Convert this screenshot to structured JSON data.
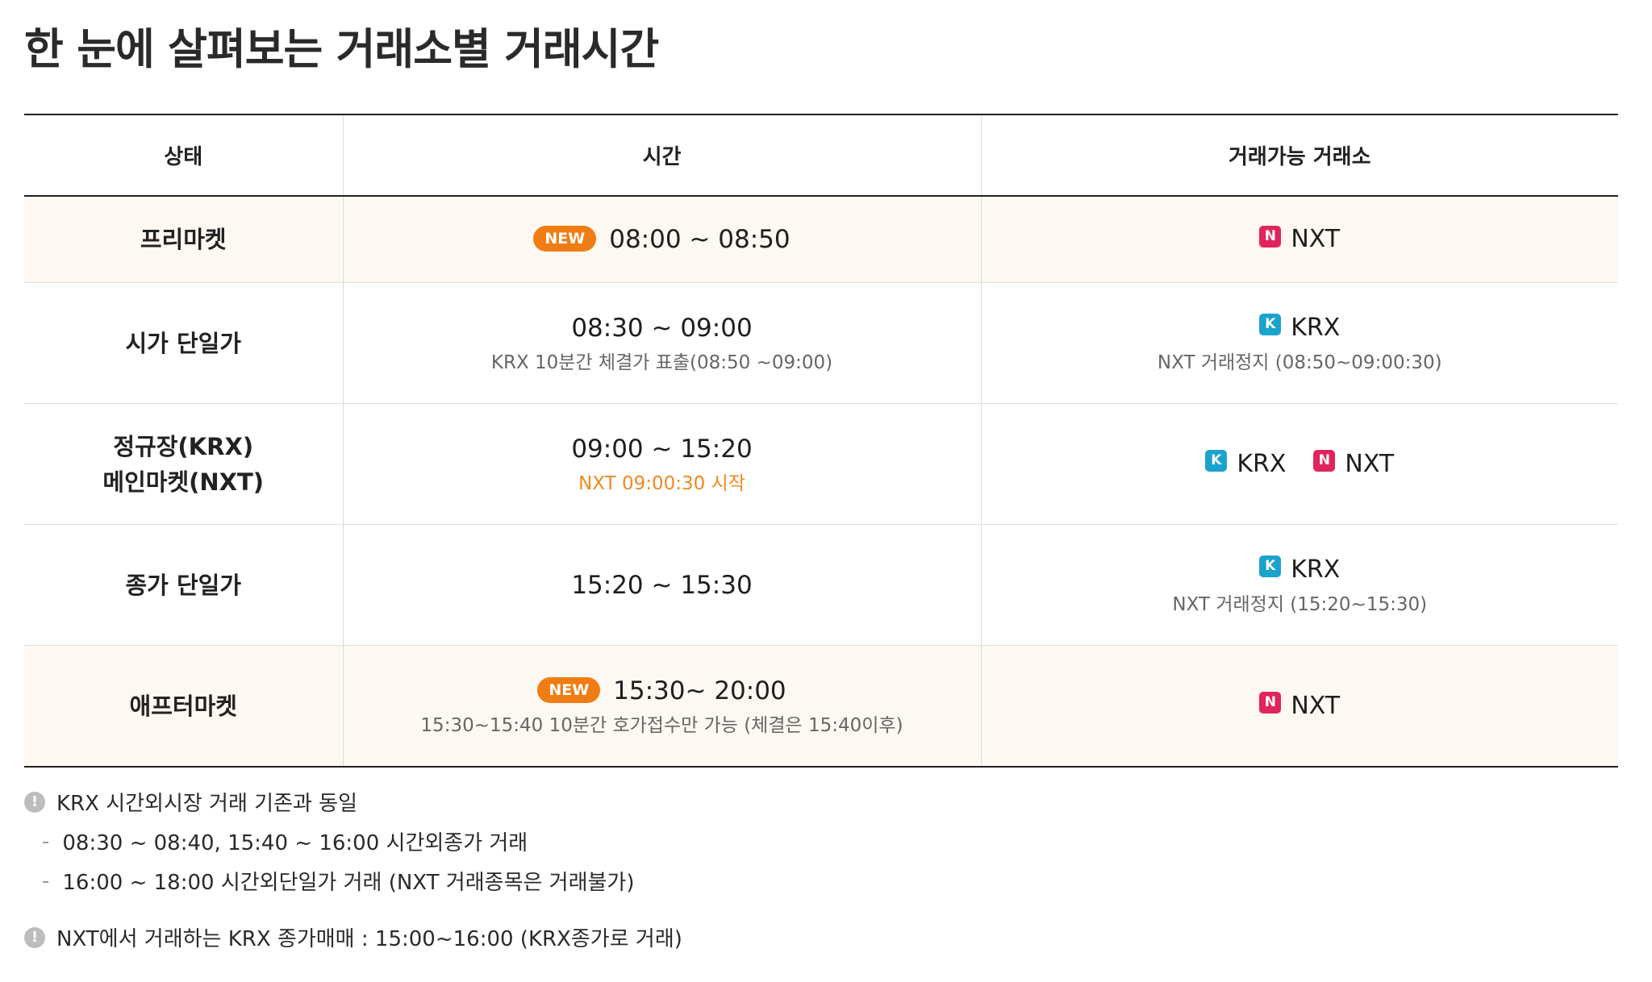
{
  "title": "한 눈에 살펴보는 거래소별 거래시간",
  "table": {
    "headers": [
      "상태",
      "시간",
      "거래가능 거래소"
    ],
    "rows": [
      {
        "state": "프리마켓",
        "badge": "NEW",
        "time": "08:00 ~ 08:50",
        "exchanges": [
          {
            "icon": "N",
            "name": "NXT"
          }
        ]
      },
      {
        "state": "시가 단일가",
        "time": "08:30 ~ 09:00",
        "time_note": "KRX 10분간 체결가 표출(08:50 ~09:00)",
        "exchanges": [
          {
            "icon": "K",
            "name": "KRX"
          }
        ],
        "exchange_note": "NXT 거래정지 (08:50~09:00:30)"
      },
      {
        "state_lines": [
          "정규장(KRX)",
          "메인마켓(NXT)"
        ],
        "time": "09:00 ~ 15:20",
        "time_note": "NXT 09:00:30 시작",
        "exchanges": [
          {
            "icon": "K",
            "name": "KRX"
          },
          {
            "icon": "N",
            "name": "NXT"
          }
        ]
      },
      {
        "state": "종가 단일가",
        "time": "15:20 ~ 15:30",
        "exchanges": [
          {
            "icon": "K",
            "name": "KRX"
          }
        ],
        "exchange_note": "NXT 거래정지 (15:20~15:30)"
      },
      {
        "state": "애프터마켓",
        "badge": "NEW",
        "time": "15:30~ 20:00",
        "time_note": "15:30~15:40 10분간 호가접수만 가능 (체결은 15:40이후)",
        "exchanges": [
          {
            "icon": "N",
            "name": "NXT"
          }
        ]
      }
    ]
  },
  "notes": {
    "note1": "KRX 시간외시장 거래 기존과 동일",
    "note1_items": [
      "08:30 ~ 08:40, 15:40 ~ 16:00 시간외종가 거래",
      "16:00 ~ 18:00 시간외단일가 거래 (NXT 거래종목은 거래불가)"
    ],
    "note2": "NXT에서 거래하는 KRX 종가매매 : 15:00~16:00 (KRX종가로 거래)",
    "dash": "-",
    "icon": "!"
  },
  "colors": {
    "highlight_row": "#fdf8f1",
    "new_badge": "#f07d13",
    "nxt_icon": "#e0245e",
    "krx_icon": "#1aa3cc",
    "orange_note": "#ef8a22"
  }
}
